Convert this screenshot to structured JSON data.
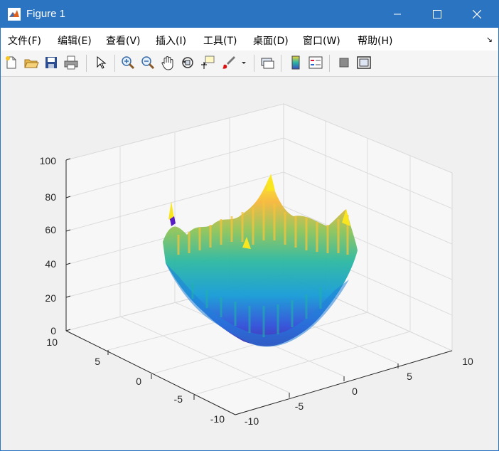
{
  "window": {
    "title": "Figure 1"
  },
  "menu": [
    {
      "label": "文件(F)"
    },
    {
      "label": "编辑(E)"
    },
    {
      "label": "查看(V)"
    },
    {
      "label": "插入(I)"
    },
    {
      "label": "工具(T)"
    },
    {
      "label": "桌面(D)"
    },
    {
      "label": "窗口(W)"
    },
    {
      "label": "帮助(H)"
    }
  ],
  "toolbar": {
    "icons": [
      "new-figure-icon",
      "open-file-icon",
      "save-icon",
      "print-icon",
      "edit-plot-arrow-icon",
      "zoom-in-icon",
      "zoom-out-icon",
      "pan-hand-icon",
      "rotate-3d-icon",
      "data-cursor-icon",
      "brush-icon",
      "brush-dropdown-icon",
      "link-plot-icon",
      "colorbar-icon",
      "legend-icon",
      "hide-plot-tools-icon",
      "show-plot-tools-icon"
    ]
  },
  "plot": {
    "z_ticks": [
      "0",
      "20",
      "40",
      "60",
      "80",
      "100"
    ],
    "x_ticks": [
      "-10",
      "-5",
      "0",
      "5",
      "10"
    ],
    "y_ticks": [
      "10",
      "5",
      "0",
      "-5",
      "-10"
    ]
  },
  "chart_data": {
    "type": "surface",
    "zlim": [
      0,
      100
    ],
    "xlim": [
      -10,
      10
    ],
    "ylim": [
      -10,
      10
    ],
    "description_values": {
      "min_z_approx": 0,
      "max_z_approx": 80
    },
    "colormap": "parula"
  }
}
